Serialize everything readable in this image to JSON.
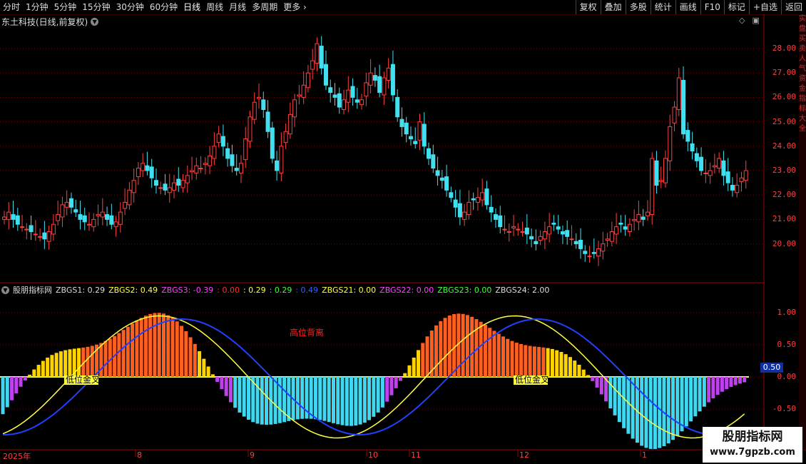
{
  "toolbar": {
    "periods": [
      "分时",
      "1分钟",
      "5分钟",
      "15分钟",
      "30分钟",
      "60分钟",
      "日线",
      "周线",
      "月线",
      "多周期",
      "更多"
    ],
    "active": "日线",
    "right_buttons": [
      "复权",
      "叠加",
      "多股",
      "统计",
      "画线",
      "F10",
      "标记",
      "+自选",
      "返回"
    ]
  },
  "stock": {
    "title": "东土科技(日线,前复权)"
  },
  "price_axis": {
    "ticks": [
      "28.00",
      "27.00",
      "26.00",
      "25.00",
      "24.00",
      "23.00",
      "22.00",
      "21.00",
      "20.00"
    ]
  },
  "indicator": {
    "name": "股朋指标网",
    "legend": [
      {
        "label": "ZBGS1: 0.29",
        "color": "#dddddd"
      },
      {
        "label": "ZBGS2: 0.49",
        "color": "#ffff40"
      },
      {
        "label": "ZBGS3: -0.39",
        "color": "#ff40ff"
      },
      {
        "label": ": 0.00",
        "color": "#ff3030"
      },
      {
        "label": ": 0.29",
        "color": "#ffff40"
      },
      {
        "label": ": 0.29",
        "color": "#40ff40"
      },
      {
        "label": ": 0.49",
        "color": "#3060ff"
      },
      {
        "label": "ZBGS21: 0.00",
        "color": "#ffff40"
      },
      {
        "label": "ZBGS22: 0.00",
        "color": "#ff40ff"
      },
      {
        "label": "ZBGS23: 0.00",
        "color": "#40ff40"
      },
      {
        "label": "ZBGS24: 2.00",
        "color": "#dddddd"
      }
    ],
    "axis_ticks": [
      "1.00",
      "0.50",
      "0.00",
      "-0.50"
    ],
    "current_value": "0.50",
    "annotations": [
      "低位金叉",
      "低位金叉",
      "高位背离"
    ]
  },
  "time_axis": {
    "labels": [
      "2025年",
      "8",
      "9",
      "10",
      "11",
      "12",
      "1"
    ]
  },
  "right_strip": "实盘买卖人气资金指标大全",
  "watermark": {
    "line1": "股朋指标网",
    "line2": "www.7gpzb.com"
  },
  "colors": {
    "up": "#ff4040",
    "down": "#40e0f0",
    "grid": "#800000"
  }
}
